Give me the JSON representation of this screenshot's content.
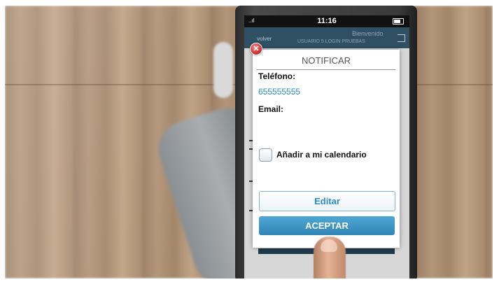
{
  "status_bar": {
    "signal": "..ıl",
    "time": "11:16"
  },
  "app_bar": {
    "back_label": "volver",
    "title": "Bienvenido",
    "subtitle": "USUARIO 5 LOGIN PRUEBAS"
  },
  "modal": {
    "title": "NOTIFICAR",
    "phone_label": "Teléfono:",
    "phone_value": "655555555",
    "email_label": "Email:",
    "email_value": "",
    "calendar_label": "Añadir a mi calendario",
    "calendar_checked": false,
    "edit_button": "Editar",
    "accept_button": "ACEPTAR"
  },
  "colors": {
    "accent": "#2a8bc7",
    "accept_bg": "#3a93c4",
    "close": "#c62828",
    "appbar": "#2f4f63"
  },
  "icons": {
    "close": "close-icon",
    "logout": "logout-icon",
    "battery": "battery-icon",
    "signal": "signal-icon"
  }
}
